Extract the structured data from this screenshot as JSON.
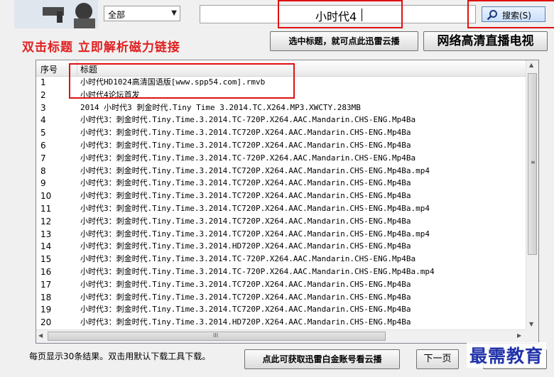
{
  "category": {
    "selected": "全部"
  },
  "search": {
    "value": "小时代4",
    "button_label": "搜索(S)"
  },
  "tagline": "双击标题 立即解析磁力链接",
  "buttons": {
    "cloud_label": "选中标题，就可点此迅雷云播",
    "tv_label": "网络高清直播电视",
    "account_label": "点此可获取迅雷白金账号看云播",
    "next_label": "下一页"
  },
  "table": {
    "headers": {
      "seq": "序号",
      "title": "标题"
    },
    "rows": [
      {
        "seq": "1",
        "title": "小时代HD1024高清国语版[www.spp54.com].rmvb"
      },
      {
        "seq": "2",
        "title": "小时代4论坛首发"
      },
      {
        "seq": "3",
        "title": "2014 小时代3 刺金时代.Tiny Time 3.2014.TC.X264.MP3.XWCTY.283MB"
      },
      {
        "seq": "4",
        "title": "小时代3：刺金时代.Tiny.Time.3.2014.TC-720P.X264.AAC.Mandarin.CHS-ENG.Mp4Ba"
      },
      {
        "seq": "5",
        "title": "小时代3：刺金时代.Tiny.Time.3.2014.TC720P.X264.AAC.Mandarin.CHS-ENG.Mp4Ba"
      },
      {
        "seq": "6",
        "title": "小时代3：刺金时代.Tiny.Time.3.2014.TC720P.X264.AAC.Mandarin.CHS-ENG.Mp4Ba"
      },
      {
        "seq": "7",
        "title": "小时代3：刺金时代.Tiny.Time.3.2014.TC-720P.X264.AAC.Mandarin.CHS-ENG.Mp4Ba"
      },
      {
        "seq": "8",
        "title": "小时代3：刺金时代.Tiny.Time.3.2014.TC720P.X264.AAC.Mandarin.CHS-ENG.Mp4Ba.mp4"
      },
      {
        "seq": "9",
        "title": "小时代3：刺金时代.Tiny.Time.3.2014.TC720P.X264.AAC.Mandarin.CHS-ENG.Mp4Ba"
      },
      {
        "seq": "10",
        "title": "小时代3：刺金时代.Tiny.Time.3.2014.TC720P.X264.AAC.Mandarin.CHS-ENG.Mp4Ba"
      },
      {
        "seq": "11",
        "title": "小时代3：刺金时代.Tiny.Time.3.2014.TC720P.X264.AAC.Mandarin.CHS-ENG.Mp4Ba.mp4"
      },
      {
        "seq": "12",
        "title": "小时代3：刺金时代.Tiny.Time.3.2014.TC720P.X264.AAC.Mandarin.CHS-ENG.Mp4Ba"
      },
      {
        "seq": "13",
        "title": "小时代3：刺金时代.Tiny.Time.3.2014.TC720P.X264.AAC.Mandarin.CHS-ENG.Mp4Ba.mp4"
      },
      {
        "seq": "14",
        "title": "小时代3：刺金时代.Tiny.Time.3.2014.HD720P.X264.AAC.Mandarin.CHS-ENG.Mp4Ba"
      },
      {
        "seq": "15",
        "title": "小时代3：刺金时代.Tiny.Time.3.2014.TC-720P.X264.AAC.Mandarin.CHS-ENG.Mp4Ba"
      },
      {
        "seq": "16",
        "title": "小时代3：刺金时代.Tiny.Time.3.2014.TC-720P.X264.AAC.Mandarin.CHS-ENG.Mp4Ba.mp4"
      },
      {
        "seq": "17",
        "title": "小时代3：刺金时代.Tiny.Time.3.2014.TC720P.X264.AAC.Mandarin.CHS-ENG.Mp4Ba"
      },
      {
        "seq": "18",
        "title": "小时代3：刺金时代.Tiny.Time.3.2014.TC720P.X264.AAC.Mandarin.CHS-ENG.Mp4Ba"
      },
      {
        "seq": "19",
        "title": "小时代3：刺金时代.Tiny.Time.3.2014.TC720P.X264.AAC.Mandarin.CHS-ENG.Mp4Ba"
      },
      {
        "seq": "20",
        "title": "小时代3：刺金时代.Tiny.Time.3.2014.HD720P.X264.AAC.Mandarin.CHS-ENG.Mp4Ba"
      }
    ]
  },
  "footer_note": "每页显示30条结果。双击用默认下载工具下载。",
  "watermark": "最需教育",
  "colors": {
    "highlight_red": "#e01010",
    "tagline_red": "#e02020",
    "watermark_blue": "#2233aa"
  },
  "icons": {
    "search": "magnifier-icon",
    "logo": "logo-image",
    "dropdown": "chevron-down-icon"
  }
}
